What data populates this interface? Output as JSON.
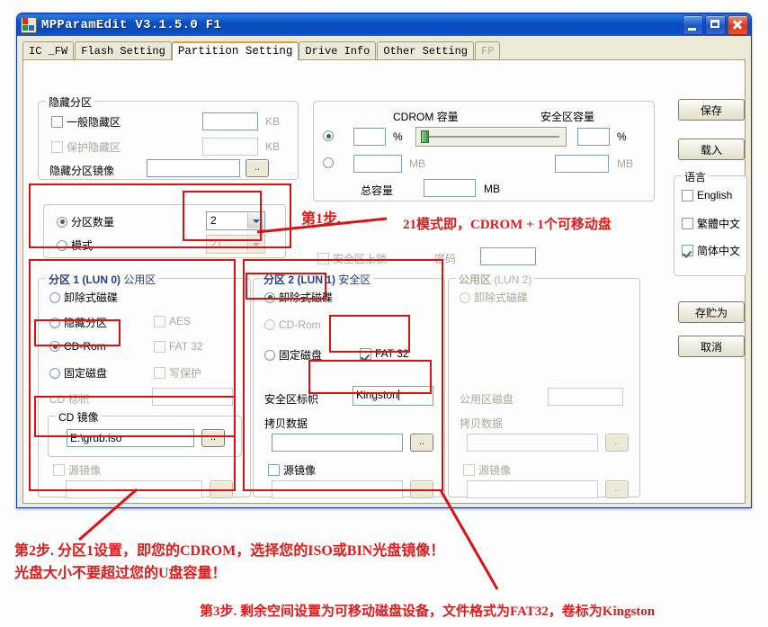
{
  "window": {
    "title": "MPParamEdit V3.1.5.0 F1",
    "icon": "app-blocks-icon",
    "minimize": "minimize-icon",
    "maximize": "maximize-icon",
    "close": "close-icon"
  },
  "tabs": [
    {
      "label": "IC _FW",
      "state": "normal"
    },
    {
      "label": "Flash Setting",
      "state": "normal"
    },
    {
      "label": "Partition Setting",
      "state": "active"
    },
    {
      "label": "Drive Info",
      "state": "normal"
    },
    {
      "label": "Other Setting",
      "state": "normal"
    },
    {
      "label": "FP",
      "state": "disabled"
    }
  ],
  "hidden_partition": {
    "legend": "隐藏分区",
    "normal_hidden": {
      "label": "一般隐藏区",
      "checked": false,
      "value": "",
      "unit": "KB"
    },
    "protect_hidden": {
      "label": "保护隐藏区",
      "checked": false,
      "value": "",
      "unit": "KB",
      "disabled": true
    },
    "image": {
      "label": "隐藏分区镜像",
      "value": "",
      "browse": ".."
    }
  },
  "capacity": {
    "cdrom_title": "CDROM 容量",
    "secure_title": "安全区容量",
    "mode_percent_selected": true,
    "cdrom_percent": "",
    "cdrom_mb": "",
    "secure_percent": "",
    "secure_mb": "",
    "percent_unit": "%",
    "mb_unit": "MB",
    "total_label": "总容量",
    "total_value": "",
    "total_unit": "MB",
    "slider_position_percent": 2
  },
  "partition_mode": {
    "count": {
      "label": "分区数量",
      "selected": true,
      "value": "2"
    },
    "mode": {
      "label": "模式",
      "selected": false,
      "value": "21",
      "disabled": true
    }
  },
  "secure_lock": {
    "label": "安全区上锁",
    "checked": false,
    "disabled": true,
    "password_label": "密码",
    "password_value": ""
  },
  "partition1": {
    "legend_main": "分区 1 (LUN 0)",
    "legend_sub": " 公用区",
    "radios": [
      {
        "label": "卸除式磁碟",
        "selected": false
      },
      {
        "label": "隐藏分区",
        "selected": false
      },
      {
        "label": "CD-Rom",
        "selected": true
      },
      {
        "label": "固定磁盘",
        "selected": false
      }
    ],
    "checks": [
      {
        "label": "AES",
        "checked": false,
        "disabled": true
      },
      {
        "label": "FAT 32",
        "checked": false,
        "disabled": true
      },
      {
        "label": "写保护",
        "checked": false,
        "disabled": true
      }
    ],
    "cd_label": {
      "label": "CD 标帜",
      "value": "",
      "disabled": true
    },
    "cd_image": {
      "legend": "CD 镜像",
      "value": "E:\\grub.iso",
      "browse": ".."
    },
    "src_image": {
      "label": "源镜像",
      "checked": false,
      "disabled": true,
      "value": "",
      "browse": ".."
    }
  },
  "partition2": {
    "legend_main": "分区 2 (LUN 1)",
    "legend_sub": " 安全区",
    "radios": [
      {
        "label": "卸除式磁碟",
        "selected": true
      },
      {
        "label": "CD-Rom",
        "selected": false,
        "disabled": true
      },
      {
        "label": "固定磁盘",
        "selected": false
      }
    ],
    "fat32": {
      "label": "FAT 32",
      "checked": true
    },
    "secure_label": {
      "label": "安全区标帜",
      "value": "Kingston"
    },
    "copy_data": {
      "label": "拷贝数据",
      "value": "",
      "browse": ".."
    },
    "src_image": {
      "label": "源镜像",
      "checked": false,
      "value": "",
      "browse": ".."
    }
  },
  "partition3": {
    "legend_main": "公用区",
    "legend_sub": " (LUN 2)",
    "radio": {
      "label": "卸除式磁碟",
      "selected": false,
      "disabled": true
    },
    "public_disk": {
      "label": "公用区磁盘",
      "value": "",
      "disabled": true
    },
    "copy_data": {
      "label": "拷贝数据",
      "value": "",
      "browse": "..",
      "disabled": true
    },
    "src_image": {
      "label": "源镜像",
      "checked": false,
      "value": "",
      "browse": "..",
      "disabled": true
    }
  },
  "sidebar": {
    "save": "保存",
    "load": "载入",
    "language_legend": "语言",
    "languages": [
      {
        "label": "English",
        "checked": false
      },
      {
        "label": "繁體中文",
        "checked": false
      },
      {
        "label": "简体中文",
        "checked": true
      }
    ],
    "save_as": "存贮为",
    "cancel": "取消"
  },
  "annotations": {
    "step1": "第1步.",
    "note_mode21": "21模式即，CDROM + 1个可移动盘",
    "step2_line1": "第2步. 分区1设置，即您的CDROM，选择您的ISO或BIN光盘镜像！",
    "step2_line2": "光盘大小不要超过您的U盘容量！",
    "step3": "第3步. 剩余空间设置为可移动磁盘设备，文件格式为FAT32，卷标为Kingston",
    "color": "#e01b1b"
  }
}
